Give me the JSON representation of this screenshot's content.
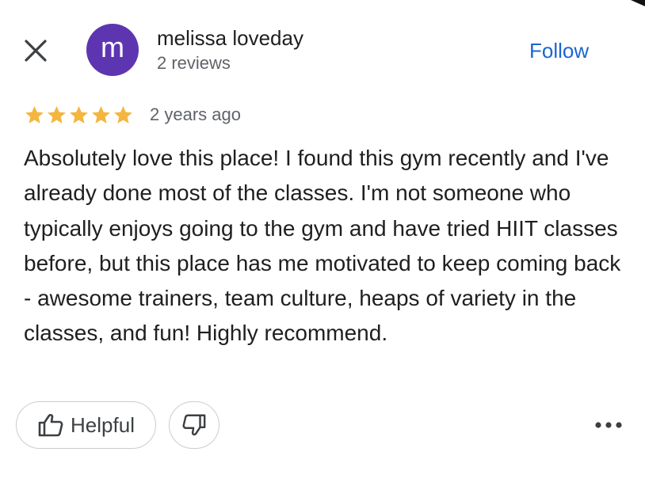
{
  "header": {
    "close_icon": "close-icon",
    "avatar_letter": "m",
    "avatar_color": "#5e35b1",
    "author_name": "melissa loveday",
    "author_meta": "2 reviews",
    "follow_label": "Follow",
    "follow_color": "#1a66d2"
  },
  "rating": {
    "stars": 5,
    "max_stars": 5,
    "star_color": "#f4b63f",
    "time_ago": "2 years ago"
  },
  "review": {
    "text": "Absolutely love this place! I found this gym recently and I've already done most of the classes. I'm not someone who typically enjoys going to the gym and have tried HIIT classes before, but this place has me motivated to keep coming back - awesome trainers, team culture, heaps of variety in the classes, and fun! Highly recommend."
  },
  "actions": {
    "helpful_label": "Helpful",
    "helpful_icon": "thumbs-up-icon",
    "not_helpful_icon": "thumbs-down-icon",
    "more_icon": "more-horizontal-icon"
  }
}
